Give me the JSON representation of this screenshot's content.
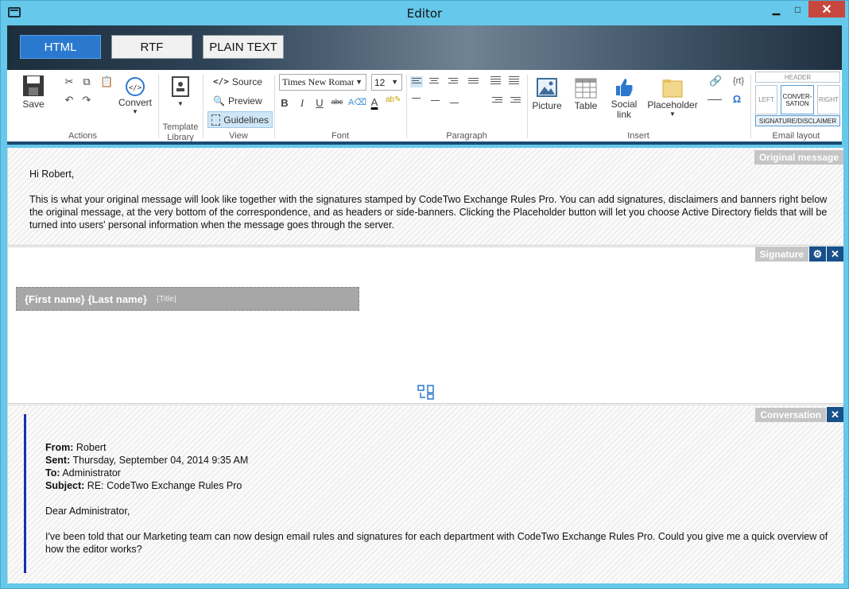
{
  "window": {
    "title": "Editor"
  },
  "format_tabs": [
    "HTML",
    "RTF",
    "PLAIN TEXT"
  ],
  "ribbon": {
    "actions": {
      "save": "Save",
      "convert": "Convert",
      "label": "Actions"
    },
    "template_library": {
      "label": "Template Library"
    },
    "view": {
      "source": "Source",
      "preview": "Preview",
      "guidelines": "Guidelines",
      "label": "View"
    },
    "font": {
      "family": "Times New Roman",
      "size": "12",
      "label": "Font"
    },
    "paragraph": {
      "label": "Paragraph"
    },
    "insert": {
      "picture": "Picture",
      "table": "Table",
      "social_link": "Social link",
      "placeholder": "Placeholder",
      "label": "Insert",
      "placeholder_glyph": "{rt}",
      "omega_glyph": "Ω"
    },
    "email_layout": {
      "header": "HEADER",
      "left": "LEFT",
      "conversation": "CONVER-SATION",
      "right": "RIGHT",
      "signature_disclaimer": "SIGNATURE/DISCLAIMER",
      "label": "Email layout"
    }
  },
  "original_message": {
    "tag": "Original message",
    "greeting": "Hi Robert,",
    "body": "This is what your original message will look like together with the signatures stamped by CodeTwo Exchange Rules Pro. You can add signatures, disclaimers and banners right below the original message, at the very bottom of the correspondence, and as headers or side-banners. Clicking the Placeholder button will let you choose Active Directory fields that will be turned into users' personal information when the message goes through the server."
  },
  "signature": {
    "tag": "Signature",
    "name": "{First name} {Last name}",
    "title": "{Title}"
  },
  "conversation": {
    "tag": "Conversation",
    "from_label": "From:",
    "from": "Robert",
    "sent_label": "Sent:",
    "sent": "Thursday, September 04, 2014 9:35 AM",
    "to_label": "To:",
    "to": "Administrator",
    "subject_label": "Subject:",
    "subject": "RE: CodeTwo Exchange Rules Pro",
    "greeting": "Dear Administrator,",
    "body": "I've been told that our Marketing team can now design email rules and signatures for each department with CodeTwo Exchange Rules Pro. Could you give me a quick overview of how the editor works?"
  },
  "colors": {
    "accent": "#2b78cf",
    "tag_bg": "#c5c5c5",
    "action_btn": "#17508a",
    "quote_bar": "#1a2fb0"
  }
}
